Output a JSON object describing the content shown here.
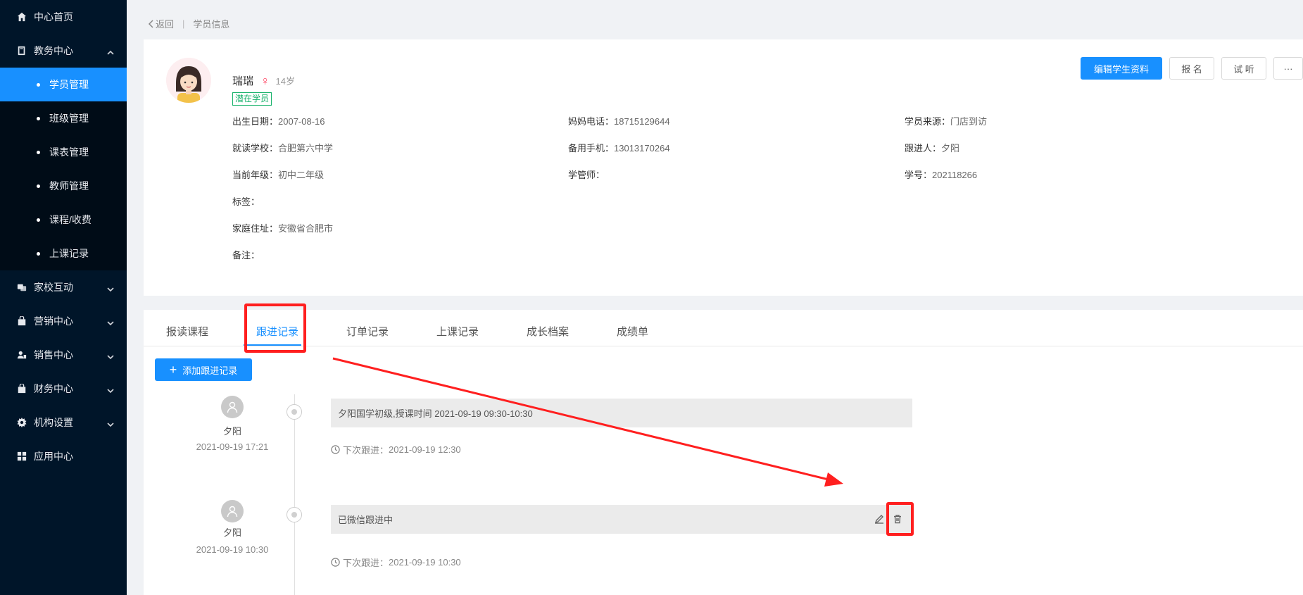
{
  "sidebar": {
    "items": [
      {
        "label": "中心首页",
        "icon": "home-icon"
      },
      {
        "label": "教务中心",
        "icon": "book-icon",
        "expanded": true,
        "children": [
          {
            "label": "学员管理",
            "active": true
          },
          {
            "label": "班级管理"
          },
          {
            "label": "课表管理"
          },
          {
            "label": "教师管理"
          },
          {
            "label": "课程/收费"
          },
          {
            "label": "上课记录"
          }
        ]
      },
      {
        "label": "家校互动",
        "icon": "interaction-icon"
      },
      {
        "label": "营销中心",
        "icon": "bag-icon"
      },
      {
        "label": "销售中心",
        "icon": "users-icon"
      },
      {
        "label": "财务中心",
        "icon": "wallet-icon"
      },
      {
        "label": "机构设置",
        "icon": "gear-icon"
      },
      {
        "label": "应用中心",
        "icon": "grid-icon"
      }
    ]
  },
  "breadcrumb": {
    "back": "返回",
    "current": "学员信息"
  },
  "student": {
    "name": "瑞瑞",
    "gender_symbol": "♀",
    "age": "14岁",
    "tag": "潜在学员",
    "fields": {
      "birth_label": "出生日期：",
      "birth": "2007-08-16",
      "school_label": "就读学校：",
      "school": "合肥第六中学",
      "grade_label": "当前年级：",
      "grade": "初中二年级",
      "tags_label": "标签：",
      "address_label": "家庭住址：",
      "address": "安徽省合肥市",
      "remark_label": "备注：",
      "mom_phone_label": "妈妈电话：",
      "mom_phone": "18715129644",
      "backup_phone_label": "备用手机：",
      "backup_phone": "13013170264",
      "manager_label": "学管师：",
      "source_label": "学员来源：",
      "source": "门店到访",
      "follower_label": "跟进人：",
      "follower": "夕阳",
      "id_label": "学号：",
      "id": "202118266"
    }
  },
  "actions": {
    "edit": "编辑学生资料",
    "enroll": "报 名",
    "trial": "试 听",
    "more": "···"
  },
  "tabs": [
    "报读课程",
    "跟进记录",
    "订单记录",
    "上课记录",
    "成长档案",
    "成绩单"
  ],
  "active_tab": "跟进记录",
  "add_button": {
    "plus": "+",
    "label": "添加跟进记录"
  },
  "records": [
    {
      "user": "夕阳",
      "time": "2021-09-19 17:21",
      "content": "夕阳国学初级,授课时间 2021-09-19 09:30-10:30",
      "next_label": "下次跟进：",
      "next": "2021-09-19 12:30"
    },
    {
      "user": "夕阳",
      "time": "2021-09-19 10:30",
      "content": "已微信跟进中",
      "next_label": "下次跟进：",
      "next": "2021-09-19 10:30"
    }
  ],
  "colors": {
    "primary": "#1890ff",
    "sidebar": "#001529",
    "annotation": "#ff1f1f",
    "tag": "#18b26b",
    "female": "#ff4d6a"
  }
}
